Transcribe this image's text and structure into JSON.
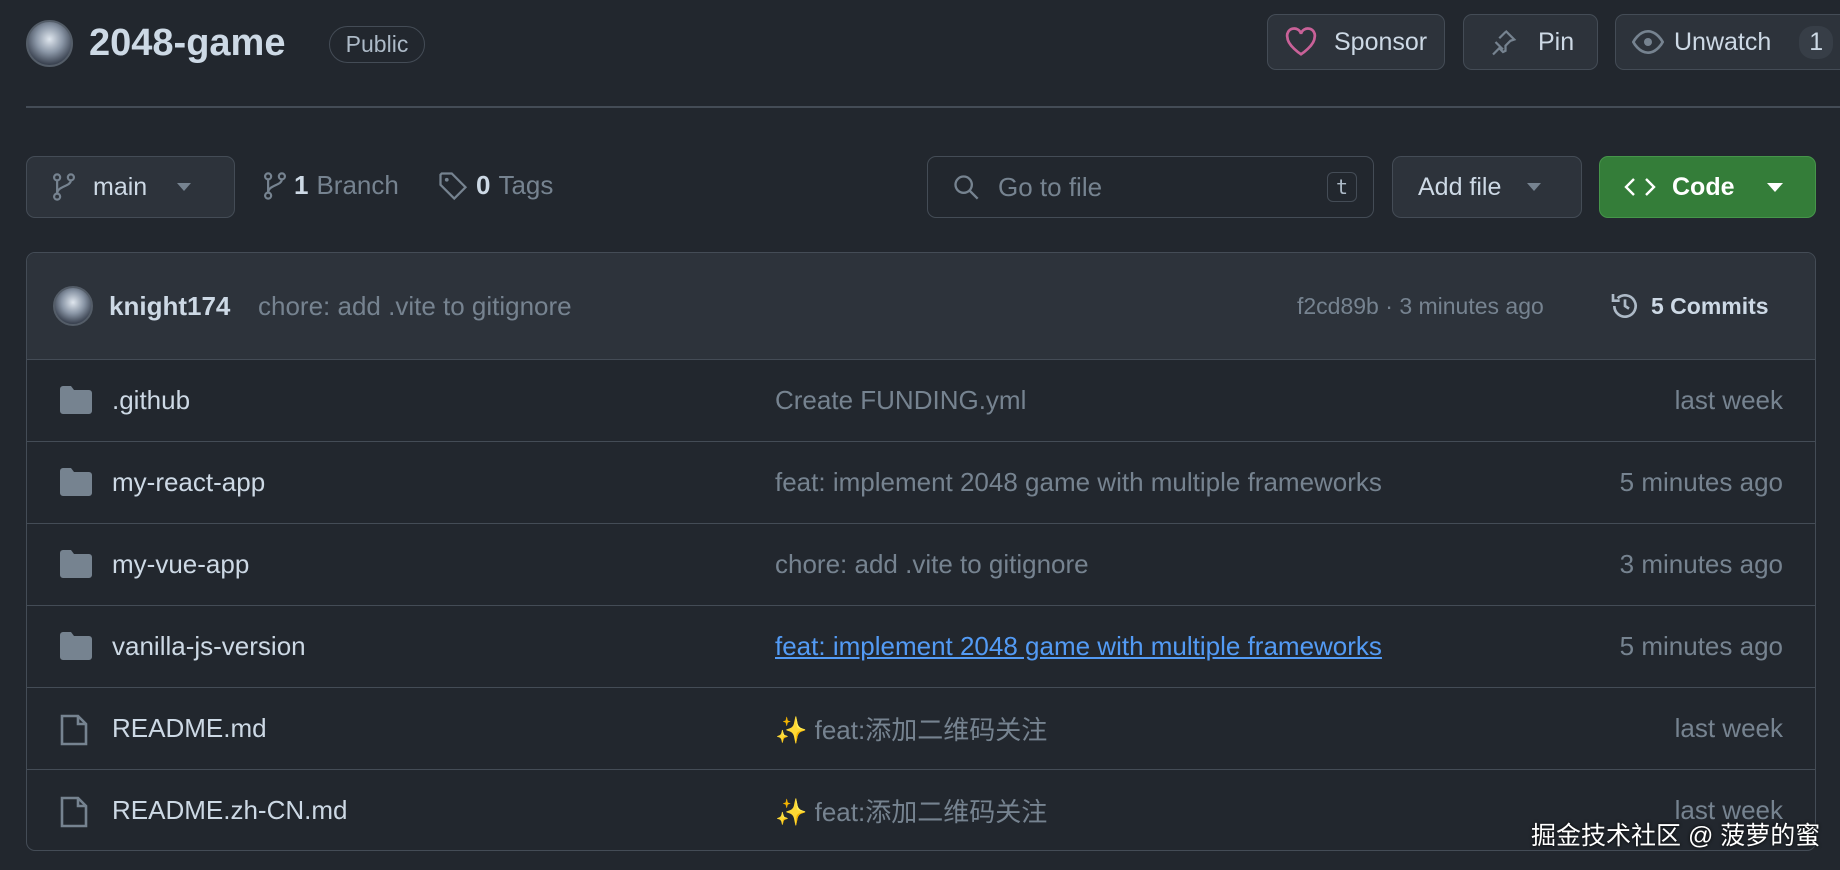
{
  "repo": {
    "name": "2048-game",
    "visibility": "Public"
  },
  "actions": {
    "sponsor": "Sponsor",
    "pin": "Pin",
    "unwatch": "Unwatch",
    "watch_count": "1"
  },
  "toolbar": {
    "branch": "main",
    "branch_count": "1",
    "branch_label": "Branch",
    "tag_count": "0",
    "tag_label": "Tags",
    "search_placeholder": "Go to file",
    "search_shortcut": "t",
    "add_file": "Add file",
    "code": "Code"
  },
  "latest_commit": {
    "author": "knight174",
    "message": "chore: add .vite to gitignore",
    "hash": "f2cd89b",
    "time": "3 minutes ago",
    "commits_label": "5 Commits"
  },
  "files": [
    {
      "type": "folder",
      "name": ".github",
      "message": "Create FUNDING.yml",
      "time": "last week"
    },
    {
      "type": "folder",
      "name": "my-react-app",
      "message": "feat: implement 2048 game with multiple frameworks",
      "time": "5 minutes ago"
    },
    {
      "type": "folder",
      "name": "my-vue-app",
      "message": "chore: add .vite to gitignore",
      "time": "3 minutes ago"
    },
    {
      "type": "folder",
      "name": "vanilla-js-version",
      "message": "feat: implement 2048 game with multiple frameworks",
      "time": "5 minutes ago"
    },
    {
      "type": "file",
      "name": "README.md",
      "message": "✨ feat:添加二维码关注",
      "time": "last week"
    },
    {
      "type": "file",
      "name": "README.zh-CN.md",
      "message": "✨ feat:添加二维码关注",
      "time": "last week"
    }
  ],
  "watermark": "掘金技术社区 @ 菠萝的蜜",
  "colors": {
    "bg": "#22272e",
    "border": "#444c56",
    "accent_green": "#347d39",
    "link": "#539bf5",
    "sponsor_heart": "#c96198"
  }
}
